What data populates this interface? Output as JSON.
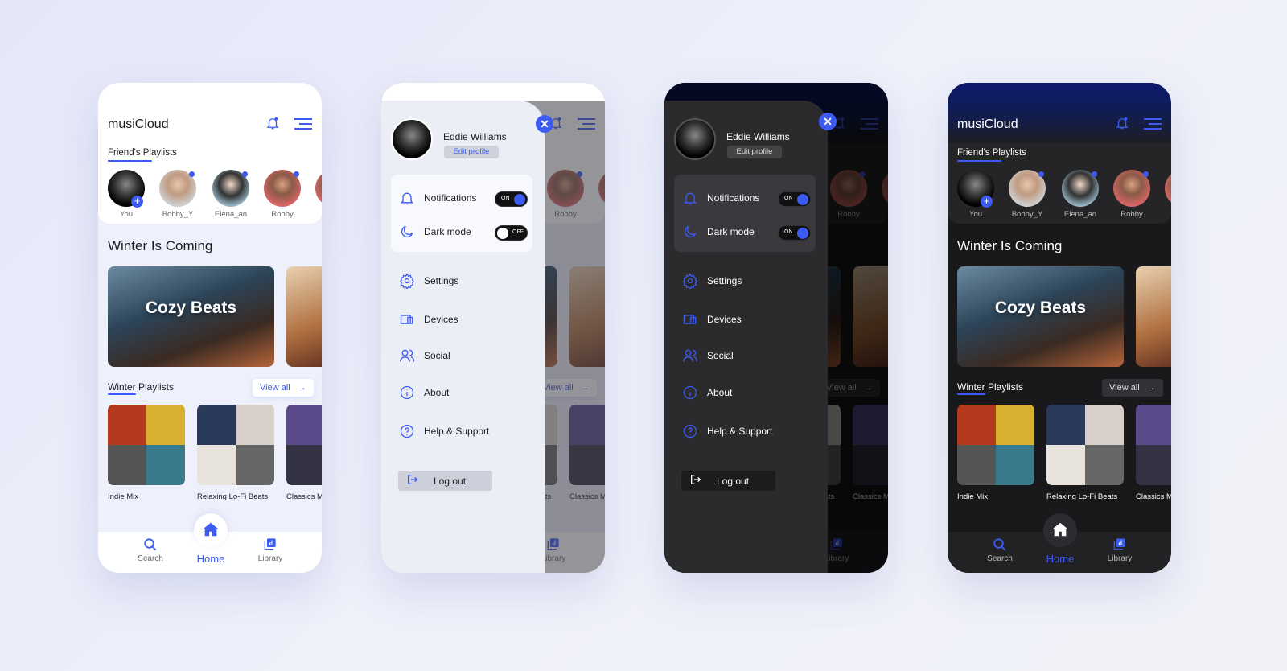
{
  "app": {
    "title": "musiCloud"
  },
  "friends": {
    "label": "Friend's Playlists",
    "users": [
      {
        "name": "You"
      },
      {
        "name": "Bobby_Y"
      },
      {
        "name": "Elena_an"
      },
      {
        "name": "Robby"
      }
    ]
  },
  "featured": {
    "heading": "Winter Is Coming",
    "card_title": "Cozy Beats"
  },
  "playlists": {
    "heading": "Winter Playlists",
    "view_all": "View all",
    "items": [
      {
        "name": "Indie Mix"
      },
      {
        "name": "Relaxing Lo-Fi Beats"
      },
      {
        "name": "Classics Mix"
      }
    ]
  },
  "nav": {
    "search": "Search",
    "home": "Home",
    "library": "Library"
  },
  "menu": {
    "user_name": "Eddie Williams",
    "edit_profile": "Edit profile",
    "notifications": {
      "label": "Notifications",
      "state": "ON"
    },
    "dark_mode_light": {
      "label": "Dark mode",
      "state": "OFF"
    },
    "dark_mode_dark": {
      "label": "Dark mode",
      "state": "ON"
    },
    "items": [
      {
        "label": "Settings",
        "icon": "gear-icon"
      },
      {
        "label": "Devices",
        "icon": "devices-icon"
      },
      {
        "label": "Social",
        "icon": "users-icon"
      },
      {
        "label": "About",
        "icon": "info-icon"
      },
      {
        "label": "Help & Support",
        "icon": "help-icon"
      }
    ],
    "logout": "Log out"
  },
  "colors": {
    "accent": "#3d5af1",
    "dark_bg": "#19191b",
    "dark_header": "#0c1a70"
  }
}
